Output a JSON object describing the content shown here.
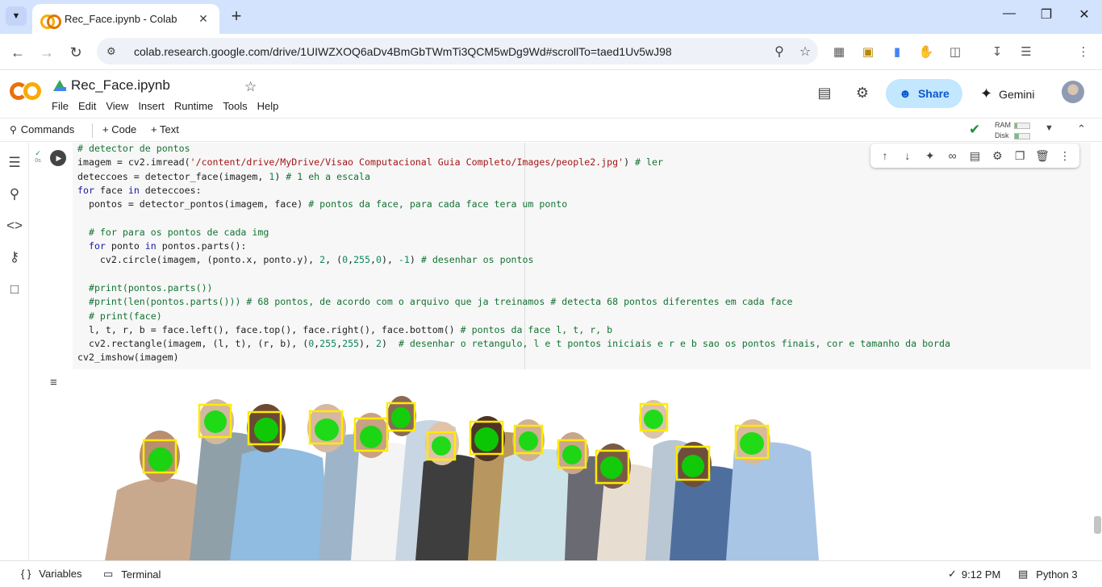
{
  "browser": {
    "tab_title": "Rec_Face.ipynb - Colab",
    "url": "colab.research.google.com/drive/1UIWZXOQ6aDv4BmGbTWmTi3QCM5wDg9Wd#scrollTo=taed1Uv5wJ98"
  },
  "notebook": {
    "name": "Rec_Face.ipynb",
    "menu": [
      "File",
      "Edit",
      "View",
      "Insert",
      "Runtime",
      "Tools",
      "Help"
    ],
    "share_label": "Share",
    "gemini_label": "Gemini"
  },
  "toolbar": {
    "commands_label": "Commands",
    "code_label": "+ Code",
    "text_label": "+ Text",
    "ram_label": "RAM",
    "disk_label": "Disk",
    "ram_usage": 0.15,
    "disk_usage": 0.25
  },
  "cell": {
    "status_time": "0s",
    "code_lines": [
      [
        [
          "c",
          "# detector de pontos"
        ]
      ],
      [
        [
          "",
          "imagem = cv2.imread("
        ],
        [
          "s",
          "'/content/drive/MyDrive/Visao Computacional Guia Completo/Images/people2.jpg'"
        ],
        [
          "",
          ") "
        ],
        [
          "c",
          "# ler"
        ]
      ],
      [
        [
          "",
          "deteccoes = detector_face(imagem, "
        ],
        [
          "n",
          "1"
        ],
        [
          "",
          ") "
        ],
        [
          "c",
          "# 1 eh a escala"
        ]
      ],
      [
        [
          "k",
          "for"
        ],
        [
          "",
          " face "
        ],
        [
          "k",
          "in"
        ],
        [
          "",
          " deteccoes:"
        ]
      ],
      [
        [
          "",
          "  pontos = detector_pontos(imagem, face) "
        ],
        [
          "c",
          "# pontos da face, para cada face tera um ponto"
        ]
      ],
      [
        [
          "",
          ""
        ]
      ],
      [
        [
          "",
          "  "
        ],
        [
          "c",
          "# for para os pontos de cada img"
        ]
      ],
      [
        [
          "",
          "  "
        ],
        [
          "k",
          "for"
        ],
        [
          "",
          " ponto "
        ],
        [
          "k",
          "in"
        ],
        [
          "",
          " pontos.parts():"
        ]
      ],
      [
        [
          "",
          "    cv2.circle(imagem, (ponto.x, ponto.y), "
        ],
        [
          "n",
          "2"
        ],
        [
          "",
          ", ("
        ],
        [
          "n",
          "0"
        ],
        [
          "",
          ","
        ],
        [
          "n",
          "255"
        ],
        [
          "",
          ","
        ],
        [
          "n",
          "0"
        ],
        [
          "",
          "), "
        ],
        [
          "n",
          "-1"
        ],
        [
          "",
          ") "
        ],
        [
          "c",
          "# desenhar os pontos"
        ]
      ],
      [
        [
          "",
          ""
        ]
      ],
      [
        [
          "",
          "  "
        ],
        [
          "c",
          "#print(pontos.parts())"
        ]
      ],
      [
        [
          "",
          "  "
        ],
        [
          "c",
          "#print(len(pontos.parts())) # 68 pontos, de acordo com o arquivo que ja treinamos # detecta 68 pontos diferentes em cada face"
        ]
      ],
      [
        [
          "",
          "  "
        ],
        [
          "c",
          "# print(face)"
        ]
      ],
      [
        [
          "",
          "  l, t, r, b = face.left(), face.top(), face.right(), face.bottom() "
        ],
        [
          "c",
          "# pontos da face l, t, r, b"
        ]
      ],
      [
        [
          "",
          "  cv2.rectangle(imagem, (l, t), (r, b), ("
        ],
        [
          "n",
          "0"
        ],
        [
          "",
          ","
        ],
        [
          "n",
          "255"
        ],
        [
          "",
          ","
        ],
        [
          "n",
          "255"
        ],
        [
          "",
          "), "
        ],
        [
          "n",
          "2"
        ],
        [
          "",
          ")  "
        ],
        [
          "c",
          "# desenhar o retangulo, l e t pontos iniciais e r e b sao os pontos finais, cor e tamanho da borda"
        ]
      ],
      [
        [
          "",
          "cv2_imshow(imagem)"
        ]
      ]
    ]
  },
  "statusbar": {
    "variables_label": "Variables",
    "terminal_label": "Terminal",
    "time": "9:12 PM",
    "kernel": "Python 3"
  },
  "colors": {
    "accent": "#0b57d0",
    "share_bg": "#c2e7ff",
    "face_box": "#ffff00",
    "landmark": "#00ff00"
  }
}
